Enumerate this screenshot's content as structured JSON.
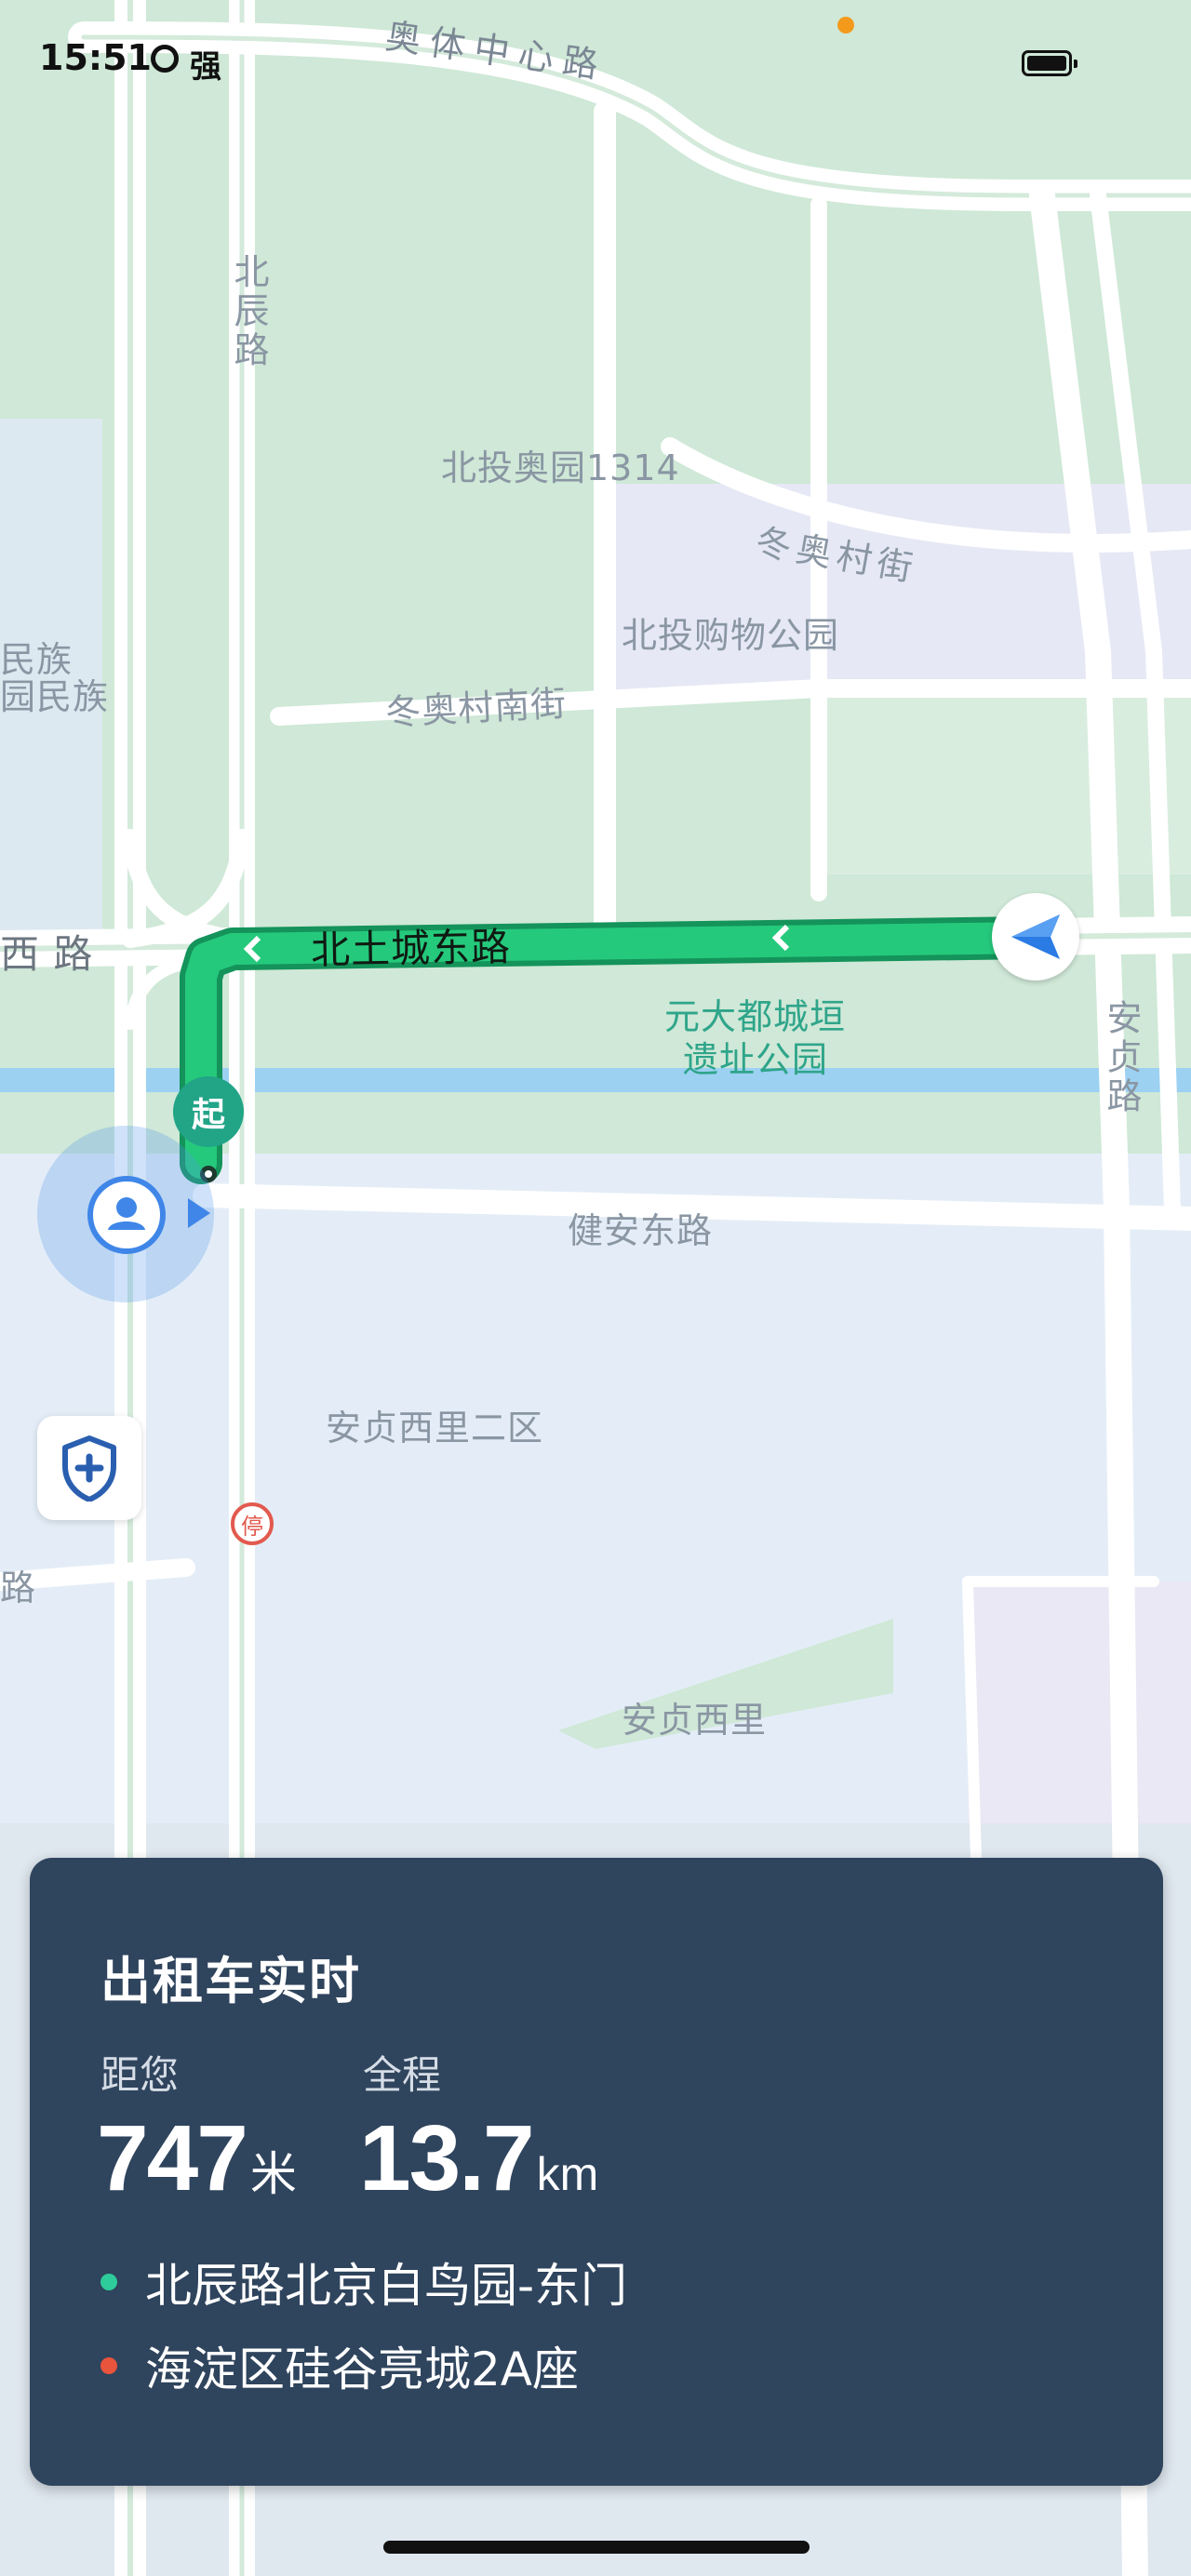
{
  "status_bar": {
    "time": "15:51",
    "signal_label": "强",
    "colors": {
      "indicator_dot": "#f39a1d"
    }
  },
  "map": {
    "labels": {
      "aoti_road": "奥体中心路",
      "beichen_road": "北辰路",
      "beitou_1314": "北投奥园1314",
      "dongaocun_street": "冬奥村街",
      "beitou_park": "北投购物公园",
      "minzu_line1": "民族",
      "minzu_line2": "园民族",
      "dongaocun_south": "冬奥村南街",
      "xi_road": "西 路",
      "beituocheng_east": "北土城东路",
      "yuandadu_line1": "元大都城垣",
      "yuandadu_line2": "遗址公园",
      "anzhen_road": "安贞路",
      "jianan_east": "健安东路",
      "anzhenxili_2": "安贞西里二区",
      "lu_left": "路",
      "anzhenxili": "安贞西里",
      "stop_sign": "停"
    },
    "start_marker": "起",
    "icons": {
      "nav_arrow": "navigation-arrow-icon",
      "user": "user-location-icon",
      "shield": "safety-shield-icon"
    },
    "colors": {
      "route": "#1fbf74",
      "route_dark": "#14935a",
      "road": "#ffffff",
      "water": "#9cd1f2"
    }
  },
  "panel": {
    "title": "出租车实时",
    "distance_label": "距您",
    "distance_value": "747",
    "distance_unit": "米",
    "total_label": "全程",
    "total_value": "13.7",
    "total_unit": "km",
    "origin": "北辰路北京白鸟园-东门",
    "destination": "海淀区硅谷亮城2A座",
    "colors": {
      "bg": "#2f445d",
      "origin_dot": "#2ecc9a",
      "destination_dot": "#e8543c"
    }
  }
}
